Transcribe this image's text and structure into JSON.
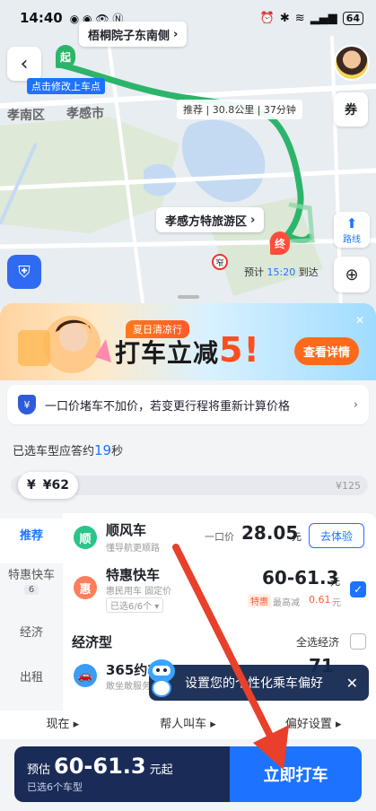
{
  "status": {
    "time": "14:40",
    "battery": "64"
  },
  "map": {
    "pickup_name": "梧桐院子东南侧",
    "pickup_hint": "点击修改上车点",
    "pickup_marker": "起",
    "destination_name": "孝感方特旅游区",
    "dest_marker": "终",
    "route_summary": "推荐 | 30.8公里 | 37分钟",
    "area_label_1": "孝南区",
    "area_label_2": "孝感市",
    "eta_prefix": "预计",
    "eta_time": "15:20",
    "eta_suffix": "到达",
    "route_line_label": "路线",
    "coupon_icon_label": "券",
    "narrow_marker": "窄"
  },
  "banner": {
    "tag": "夏日清凉行",
    "title": "打车立减",
    "title_big": "5!",
    "button": "查看详情"
  },
  "notice": {
    "icon": "¥",
    "text": "一口价堵车不加价，若变更行程将重新计算价格"
  },
  "selection": {
    "prefix": "已选车型应答约",
    "seconds": "19",
    "suffix": "秒"
  },
  "slider": {
    "min_label": "¥",
    "current": "¥62",
    "max": "¥125",
    "level": 0.17
  },
  "side_nav": [
    {
      "label": "推荐"
    },
    {
      "label": "特惠快车",
      "badge": "6"
    },
    {
      "label": "经济"
    },
    {
      "label": "出租"
    }
  ],
  "rows": {
    "shunfeng": {
      "icon": "顺",
      "title": "顺风车",
      "sub": "懂导航更顺路",
      "price_prefix": "一口价",
      "price": "28.05",
      "unit": "元",
      "action": "去体验"
    },
    "tehui": {
      "icon": "惠",
      "title": "特惠快车",
      "sub": "惠民用车 固定价",
      "picked": "已选6/6个",
      "price": "60-61.3",
      "unit": "元",
      "tag": "特惠",
      "max_reduce": "最高减",
      "reduce_value": "0.61",
      "reduce_unit": "元"
    },
    "economy_header": "经济型",
    "select_all": "全选经济",
    "car365": {
      "title": "365约车",
      "sub": "敢坐敢服务",
      "price_partial": "71"
    }
  },
  "pref_tip": "设置您的个性化乘车偏好",
  "bottom_options": [
    "现在 ▸",
    "帮人叫车 ▸",
    "偏好设置 ▸"
  ],
  "cta": {
    "est_label": "预估",
    "est_price": "60-61.3",
    "est_unit": "元起",
    "selected": "已选6个车型",
    "action": "立即打车"
  },
  "colors": {
    "accent": "#1d73ff",
    "route": "#2cb56a",
    "cta_dark": "#1a2b57",
    "promo": "#ff5a2a",
    "annotation_arrow": "#e8402a"
  }
}
